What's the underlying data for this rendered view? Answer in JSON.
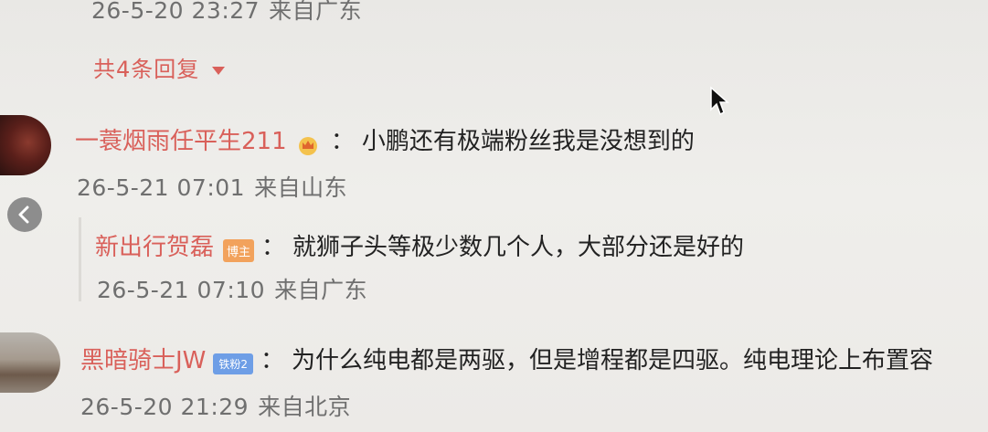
{
  "top": {
    "meta_time": "26-5-20 23:27",
    "meta_place": "来自广东",
    "reply_toggle": "共4条回复",
    "reply_toggle_icon": "triangle-down"
  },
  "comment1": {
    "user": "一蓑烟雨任平生211",
    "badge_icon": "crown",
    "colon": "：",
    "text": "小鹏还有极端粉丝我是没想到的",
    "time": "26-5-21 07:01",
    "place": "来自山东"
  },
  "reply1": {
    "user": "新出行贺磊",
    "badge": "博主",
    "colon": "：",
    "text": "就狮子头等极少数几个人，大部分还是好的",
    "time": "26-5-21 07:10",
    "place": "来自广东"
  },
  "comment2": {
    "user": "黑暗骑士JW",
    "badge": "铁粉2",
    "colon": "：",
    "text": "为什么纯电都是两驱，但是增程都是四驱。纯电理论上布置容",
    "time": "26-5-20 21:29",
    "place": "来自北京"
  },
  "nav": {
    "back_icon": "chevron-left"
  },
  "colors": {
    "name": "#d9605a",
    "badge_host": "#f2a25c",
    "badge_level": "#6e9ee6"
  }
}
